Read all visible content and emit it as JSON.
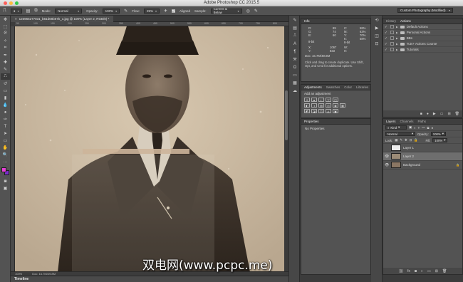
{
  "app": {
    "title": "Adobe Photoshop CC 2015.5",
    "window_dot_colors": [
      "#fc605c",
      "#fdbc40",
      "#34c84a"
    ]
  },
  "options_bar": {
    "mode_label": "Mode:",
    "mode_value": "Normal",
    "opacity_label": "Opacity:",
    "opacity_value": "100%",
    "flow_label": "Flow:",
    "flow_value": "25%",
    "aligned_label": "Aligned",
    "sample_label": "Sample:",
    "sample_value": "Current & Below",
    "workspace_value": "Custom Photography (Modified)"
  },
  "document": {
    "tab_label": "125965277031_b61d68b67b_o.jpg @ 100% (Layer 2, RGB/8) *",
    "ruler_ticks": [
      "50",
      "100",
      "150",
      "200",
      "250",
      "300",
      "350",
      "400",
      "450",
      "500",
      "550",
      "600",
      "650",
      "700",
      "750",
      "800"
    ],
    "status_zoom": "100%",
    "status_doc": "Doc: 16.7M/49.8M"
  },
  "timeline": {
    "label": "Timeline"
  },
  "watermark": {
    "text": "双电网(www.pcpc.me)"
  },
  "info_panel": {
    "tab": "Info",
    "rgb_labels": [
      "R:",
      "G:",
      "B:"
    ],
    "rgb_values": [
      "89",
      "74",
      "60"
    ],
    "cmyk_labels": [
      "C:",
      "M:",
      "Y:",
      "K:"
    ],
    "cmyk_values": [
      "58%",
      "63%",
      "70%",
      "58%"
    ],
    "bit_left": "8-bit",
    "bit_right": "8-bit",
    "x_label": "X:",
    "y_label": "Y:",
    "x_value": "1067",
    "y_value": "833",
    "w_label": "W:",
    "h_label": "H:",
    "doc_text": "Doc: 16.7M/49.8M",
    "help_text": "Click and drag to create duplicate. Use Shift, Opt, and Cmd for additional options."
  },
  "adjustments_panel": {
    "tabs": [
      "Adjustments",
      "Swatches",
      "Color",
      "Libraries"
    ],
    "heading": "Add an adjustment",
    "row1_icons": [
      "☀",
      "▲",
      "◐",
      "▽",
      "◫"
    ],
    "row2_icons": [
      "◧",
      "◑",
      "▨",
      "◎",
      "◉",
      "▦"
    ],
    "row3_icons": [
      "◩",
      "◪",
      "◫",
      "◭",
      "▣"
    ]
  },
  "properties_panel": {
    "tab": "Properties",
    "text": "No Properties"
  },
  "history_panel": {
    "tabs": [
      "History",
      "Actions"
    ],
    "actions": [
      "Default Actions",
      "Personal Actions",
      "BBs",
      "Tuts+ Actions Course",
      "Tutorials"
    ]
  },
  "layers_panel": {
    "tabs": [
      "Layers",
      "Channels",
      "Paths"
    ],
    "kind_label": "Kind",
    "blend_mode": "Normal",
    "opacity_label": "Opacity:",
    "opacity_value": "100%",
    "lock_label": "Lock:",
    "fill_label": "Fill:",
    "fill_value": "100%",
    "layers": [
      {
        "name": "Layer 1",
        "visible": false,
        "selected": false,
        "thumb": "#ececec"
      },
      {
        "name": "Layer 2",
        "visible": true,
        "selected": true,
        "thumb": "#9b8b77"
      },
      {
        "name": "Background",
        "visible": true,
        "selected": false,
        "thumb": "#8a7663"
      }
    ]
  }
}
